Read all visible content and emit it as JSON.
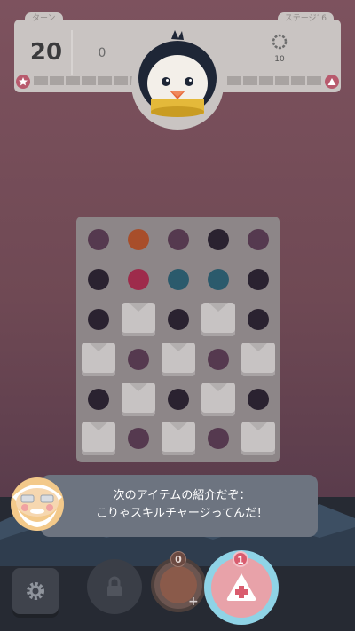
{
  "header": {
    "turn_label": "ターン",
    "turns_left": "20",
    "score": "0",
    "stage_label": "ステージ16",
    "stage_count": "10"
  },
  "dialog": {
    "line1": "次のアイテムの紹介だぞ：",
    "line2": "こりゃスキルチャージってんだ！"
  },
  "items": {
    "item_a_count": "0",
    "item_b_count": "1"
  },
  "colors": {
    "dot_purple": "#55394f",
    "dot_orange": "#a84e2a",
    "dot_dark": "#2a2230",
    "dot_red": "#9e2b4b",
    "dot_teal": "#2b5a6c"
  }
}
